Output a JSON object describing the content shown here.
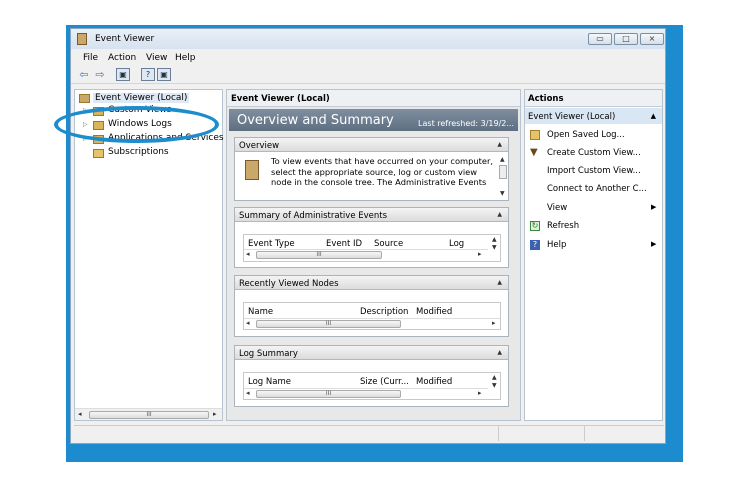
{
  "window": {
    "title": "Event Viewer",
    "minimize": "▭",
    "maximize": "□",
    "close": "⨯"
  },
  "menu": [
    "File",
    "Action",
    "View",
    "Help"
  ],
  "tree": {
    "root": "Event Viewer (Local)",
    "items": [
      "Custom Views",
      "Windows Logs",
      "Applications and Services Lo",
      "Subscriptions"
    ]
  },
  "left_scroll_thumb": "III",
  "center": {
    "pane_title": "Event Viewer (Local)",
    "heading": "Overview and Summary",
    "last_refreshed": "Last refreshed: 3/19/2...",
    "overview": {
      "title": "Overview",
      "text": "To view events that have occurred on your computer, select the appropriate source, log or custom view node in the console tree. The Administrative Events"
    },
    "summary": {
      "title": "Summary of Administrative Events",
      "columns": [
        "Event Type",
        "Event ID",
        "Source",
        "Log"
      ]
    },
    "recent": {
      "title": "Recently Viewed Nodes",
      "columns": [
        "Name",
        "Description",
        "Modified"
      ]
    },
    "logsummary": {
      "title": "Log Summary",
      "columns": [
        "Log Name",
        "Size (Curr...",
        "Modified"
      ]
    },
    "scroll_thumb": "III"
  },
  "actions": {
    "title": "Actions",
    "group": "Event Viewer (Local)",
    "items": [
      "Open Saved Log...",
      "Create Custom View...",
      "Import Custom View...",
      "Connect to Another C...",
      "View",
      "Refresh",
      "Help"
    ]
  },
  "colors": {
    "frame_blue": "#1d8ccf",
    "header_gray": "#6f7f91"
  }
}
